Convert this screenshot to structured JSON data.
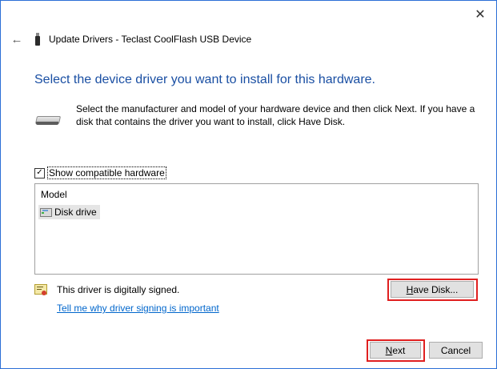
{
  "window": {
    "title": "Update Drivers - Teclast CoolFlash USB Device",
    "close_glyph": "✕",
    "back_glyph": "←"
  },
  "heading": "Select the device driver you want to install for this hardware.",
  "intro_text": "Select the manufacturer and model of your hardware device and then click Next. If you have a disk that contains the driver you want to install, click Have Disk.",
  "compatible_checkbox": {
    "label": "Show compatible hardware",
    "checked": true,
    "check_glyph": "✓"
  },
  "model_list": {
    "column_header": "Model",
    "items": [
      {
        "label": "Disk drive",
        "selected": true
      }
    ]
  },
  "signing": {
    "status_text": "This driver is digitally signed.",
    "link_text": "Tell me why driver signing is important"
  },
  "buttons": {
    "have_disk_label": "Have Disk...",
    "have_disk_accel": "H",
    "have_disk_rest": "ave Disk...",
    "next_label": "Next",
    "next_accel": "N",
    "next_rest": "ext",
    "cancel_label": "Cancel"
  },
  "colors": {
    "heading": "#1a4fa3",
    "link": "#0066cc",
    "highlight": "#e02020",
    "window_border": "#2b6fd6"
  },
  "icons": {
    "back": "back-arrow-icon",
    "device": "usb-drive-icon",
    "hardware": "disk-drive-icon",
    "list_item": "disk-drive-small-icon",
    "signed": "certificate-icon",
    "close": "close-icon"
  }
}
